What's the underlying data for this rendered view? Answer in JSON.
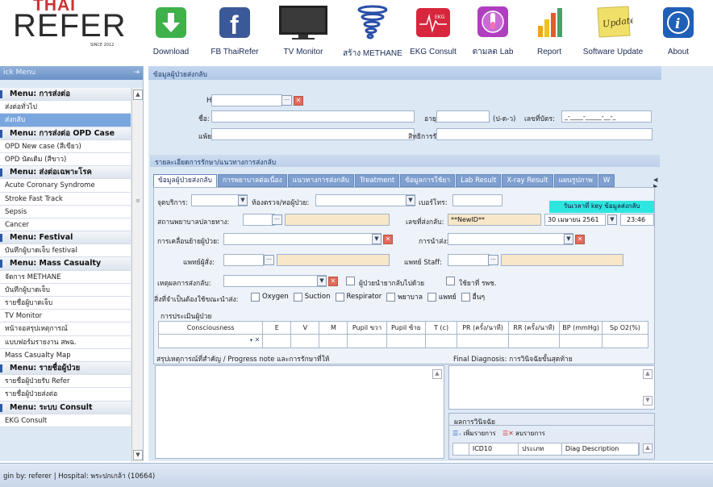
{
  "logo": {
    "thai": "THAI",
    "refer": "REFER",
    "since": "SINCE 2012"
  },
  "toolbar": [
    {
      "label": "Download",
      "icon": "download-icon",
      "color": "#3fb14a"
    },
    {
      "label": "FB ThaiRefer",
      "icon": "facebook-icon",
      "color": "#3b5998"
    },
    {
      "label": "TV Monitor",
      "icon": "tv-monitor-icon",
      "color": "#222222"
    },
    {
      "label": "สร้าง METHANE",
      "icon": "tornado-icon",
      "color": "#2a4fa8"
    },
    {
      "label": "EKG Consult",
      "icon": "ekg-icon",
      "color": "#d7263d"
    },
    {
      "label": "ตามลต Lab",
      "icon": "lab-tube-icon",
      "color": "#b03fbf"
    },
    {
      "label": "Report",
      "icon": "bar-chart-icon",
      "color": "#f2a21b"
    },
    {
      "label": "Software Update",
      "icon": "update-note-icon",
      "color": "#f0e06a"
    },
    {
      "label": "About",
      "icon": "info-icon",
      "color": "#1f5fb8"
    }
  ],
  "quickmenu": {
    "title": "ick Menu",
    "items": [
      {
        "label": "Menu: การส่งต่อ",
        "type": "head"
      },
      {
        "label": "ส่งต่อทั่วไป",
        "type": "item"
      },
      {
        "label": "ส่งกลับ",
        "type": "selected"
      },
      {
        "label": "Menu: การส่งต่อ OPD Case",
        "type": "head"
      },
      {
        "label": "OPD New case (สีเขียว)",
        "type": "item"
      },
      {
        "label": "OPD นัดเดิม (สีขาว)",
        "type": "item"
      },
      {
        "label": "Menu: ส่งต่อเฉพาะโรค",
        "type": "head"
      },
      {
        "label": "Acute Coronary Syndrome",
        "type": "item"
      },
      {
        "label": "Stroke Fast Track",
        "type": "item"
      },
      {
        "label": "Sepsis",
        "type": "item"
      },
      {
        "label": "Cancer",
        "type": "item"
      },
      {
        "label": "Menu: Festival",
        "type": "head"
      },
      {
        "label": "บันทึกผู้บาดเจ็บ festival",
        "type": "item"
      },
      {
        "label": "Menu: Mass Casualty",
        "type": "head"
      },
      {
        "label": "จัดการ METHANE",
        "type": "item"
      },
      {
        "label": "บันทึกผู้บาดเจ็บ",
        "type": "item"
      },
      {
        "label": "รายชื่อผู้บาดเจ็บ",
        "type": "item"
      },
      {
        "label": "TV Monitor",
        "type": "item"
      },
      {
        "label": "หน้าจอสรุปเหตุการณ์",
        "type": "item"
      },
      {
        "label": "แบบฟอร์มรายงาน สพฉ.",
        "type": "item"
      },
      {
        "label": "Mass Casualty Map",
        "type": "item"
      },
      {
        "label": "Menu: รายชื่อผู้ป่วย",
        "type": "head"
      },
      {
        "label": "รายชื่อผู้ป่วยรับ Refer",
        "type": "item"
      },
      {
        "label": "รายชื่อผู้ป่วยส่งต่อ",
        "type": "item"
      },
      {
        "label": "Menu: ระบบ Consult",
        "type": "head"
      },
      {
        "label": "EKG Consult",
        "type": "item"
      }
    ]
  },
  "main": {
    "panel_title": "ข้อมูลผู้ป่วยส่งกลับ",
    "hn_label": "HN:",
    "name_label": "ชื่อ:",
    "age_label": "อายุ:",
    "age_hint": "(ป-ด-ว)",
    "idcard_label": "เลขที่บัตร:",
    "idcard_value": "_-____-_____-__-_",
    "allergy_label": "แพ้ยา:",
    "rights_label": "สิทธิการรักษา:",
    "detail_title": "รายละเอียดการรักษา/แนวทางการส่งกลับ",
    "tabs": [
      "ข้อมูลผู้ป่วยส่งกลับ",
      "การพยาบาลต่อเนื่อง",
      "แนวทางการส่งกลับ",
      "Treatment",
      "ข้อมูลการใช้ยา",
      "Lab Result",
      "X-ray Result",
      "แผนรูปภาพ",
      "W"
    ],
    "service_label": "จุดบริการ:",
    "room_label": "ห้องตรวจ/หอผู้ป่วย:",
    "phone_label": "เบอร์โทร:",
    "key_time_label": "วันเวลาที่ key ข้อมูลส่งกลับ",
    "dest_label": "สถานพยาบาลปลายทาง:",
    "refer_no_label": "เลขที่ส่งกลับ:",
    "refer_no_value": "**NewID**",
    "date_value": "30 เมษายน 2561",
    "time_value": "23:46",
    "move_label": "การเคลื่อนย้ายผู้ป่วย:",
    "transport_label": "การนำส่ง:",
    "doctor_label": "แพทย์ผู้สั่ง:",
    "staff_label": "แพทย์ Staff:",
    "reason_label": "เหตุผลการส่งกลับ:",
    "relative_label": "ผู้ป่วยนำยากลับไปด้วย",
    "ems_label": "ใช้ยาที่ รพช.",
    "needs_label": "สิ่งที่จำเป็นต้องใช้ขณะนำส่ง:",
    "needs": [
      "Oxygen",
      "Suction",
      "Respirator",
      "พยาบาล",
      "แพทย์",
      "อื่นๆ"
    ],
    "assess_label": "การประเมินผู้ป่วย",
    "vital_cols": [
      "Consciousness",
      "E",
      "V",
      "M",
      "Pupil ขวา",
      "Pupil ซ้าย",
      "T (c)",
      "PR (ครั้ง/นาที)",
      "RR (ครั้ง/นาที)",
      "BP (mmHg)",
      "Sp O2(%)"
    ],
    "progress_label": "สรุปเหตุการณ์ที่สำคัญ / Progress note และการรักษาที่ให้",
    "final_dx_label": "Final Diagnosis: การวินิจฉัยขั้นสุดท้าย",
    "dx_result_label": "ผลการวินิจฉัย",
    "add_item": "เพิ่มรายการ",
    "del_item": "ลบรายการ",
    "dx_cols": [
      "ICD10",
      "ประเภท",
      "Diag Description"
    ]
  },
  "status": {
    "text": "gin by: referer  |  Hospital: พระปกเกล้า (10664)"
  }
}
